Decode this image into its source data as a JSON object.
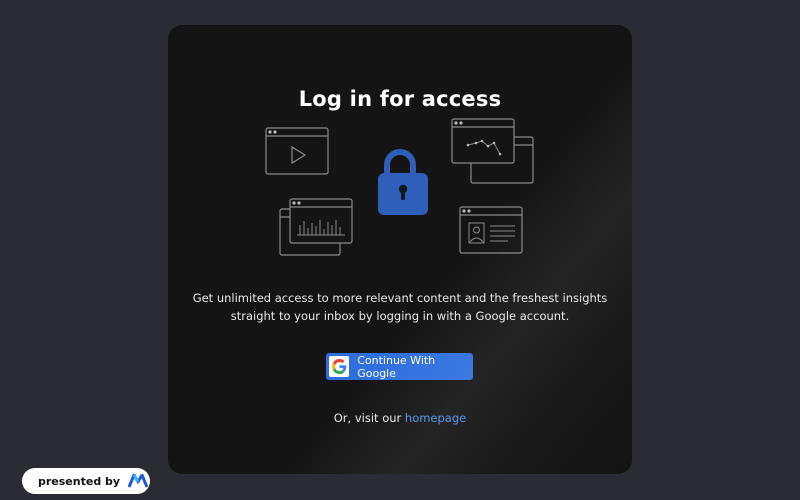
{
  "dialog": {
    "title": "Log in for access",
    "description": "Get unlimited access to more relevant content and the freshest insights straight to your inbox by logging in with a Google account.",
    "google_button_label": "Continue With Google",
    "visit_prefix": "Or, visit our ",
    "homepage_link": "homepage"
  },
  "badge": {
    "text": "presented by"
  },
  "icons": {
    "lock": "lock-icon",
    "google": "google-icon",
    "video": "video-window-icon",
    "bar_chart": "bar-chart-window-icon",
    "line_chart": "line-chart-window-icon",
    "profile": "profile-window-icon",
    "brand": "brand-logo-icon"
  },
  "colors": {
    "page_bg": "#2b2c33",
    "card_bg": "#141414",
    "accent": "#2f6fe0",
    "link": "#4f8ff0",
    "lock": "#2f5fb8"
  }
}
